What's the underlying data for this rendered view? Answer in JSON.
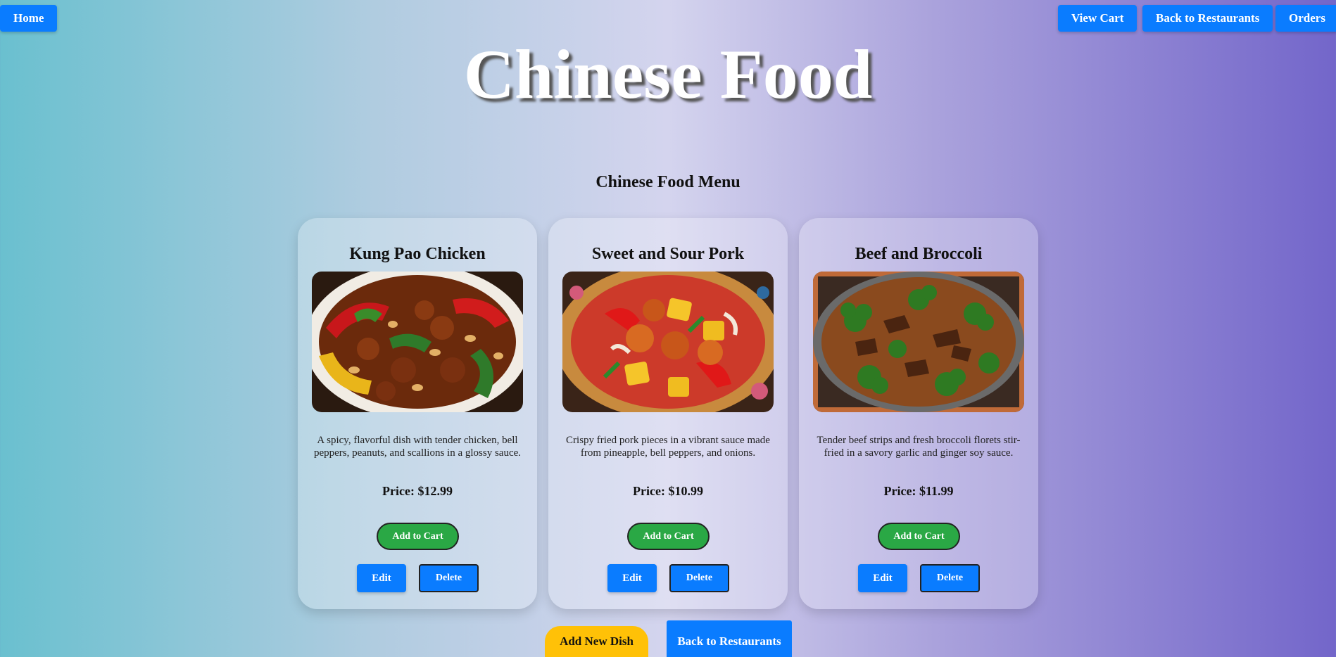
{
  "nav": {
    "home_label": "Home",
    "view_cart_label": "View Cart",
    "back_label": "Back to Restaurants",
    "orders_label": "Orders"
  },
  "page": {
    "title": "Chinese Food",
    "menu_title": "Chinese Food Menu"
  },
  "dishes": [
    {
      "name": "Kung Pao Chicken",
      "description": "A spicy, flavorful dish with tender chicken, bell peppers, peanuts, and scallions in a glossy sauce.",
      "price": "Price: $12.99",
      "add_label": "Add to Cart",
      "edit_label": "Edit",
      "delete_label": "Delete"
    },
    {
      "name": "Sweet and Sour Pork",
      "description": "Crispy fried pork pieces in a vibrant sauce made from pineapple, bell peppers, and onions.",
      "price": "Price: $10.99",
      "add_label": "Add to Cart",
      "edit_label": "Edit",
      "delete_label": "Delete"
    },
    {
      "name": "Beef and Broccoli",
      "description": "Tender beef strips and fresh broccoli florets stir-fried in a savory garlic and ginger soy sauce.",
      "price": "Price: $11.99",
      "add_label": "Add to Cart",
      "edit_label": "Edit",
      "delete_label": "Delete"
    }
  ],
  "footer": {
    "add_dish_label": "Add New Dish",
    "back_label": "Back to Restaurants"
  },
  "colors": {
    "primary_blue": "#0a7cff",
    "add_green": "#2aa845",
    "add_dish_yellow": "#ffc107"
  }
}
